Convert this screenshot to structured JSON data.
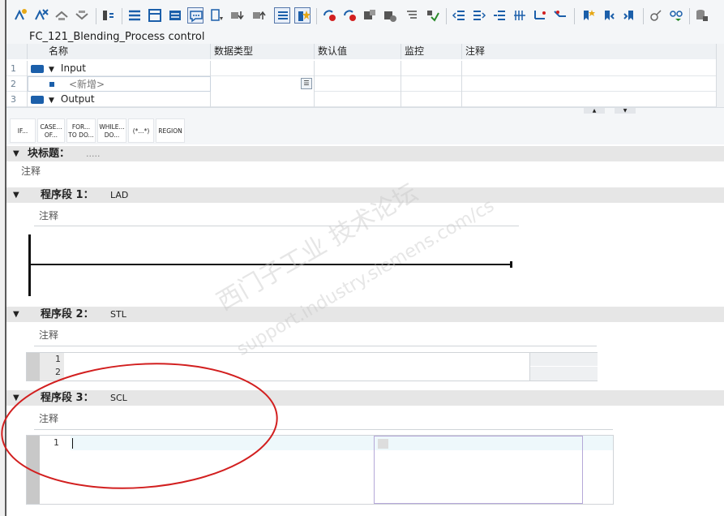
{
  "block": {
    "title": "FC_121_Blending_Process control"
  },
  "interface": {
    "headers": [
      "名称",
      "数据类型",
      "数认值",
      "监控",
      "注释"
    ],
    "rows": [
      {
        "num": "1",
        "name": "Input"
      },
      {
        "num": "2",
        "name": "<新增>"
      },
      {
        "num": "3",
        "name": "Output"
      }
    ]
  },
  "instructions": [
    "IF...",
    "CASE... OF...",
    "FOR... TO DO...",
    "WHILE... DO...",
    "(*...*)",
    "REGION"
  ],
  "block_title": {
    "label": "块标题：",
    "value": ".....",
    "comment": "注释"
  },
  "networks": [
    {
      "title": "程序段 1：",
      "lang": "LAD",
      "comment": "注释"
    },
    {
      "title": "程序段 2：",
      "lang": "STL",
      "comment": "注释",
      "lines": [
        "1",
        "2"
      ]
    },
    {
      "title": "程序段 3：",
      "lang": "SCL",
      "comment": "注释",
      "lines": [
        "1"
      ]
    }
  ],
  "watermark": {
    "line1": "西门子工业 技术论坛",
    "line2": "support.industry.siemens.com/cs"
  },
  "colors": {
    "accent": "#1b5faa",
    "annotation": "#d21f1f"
  }
}
